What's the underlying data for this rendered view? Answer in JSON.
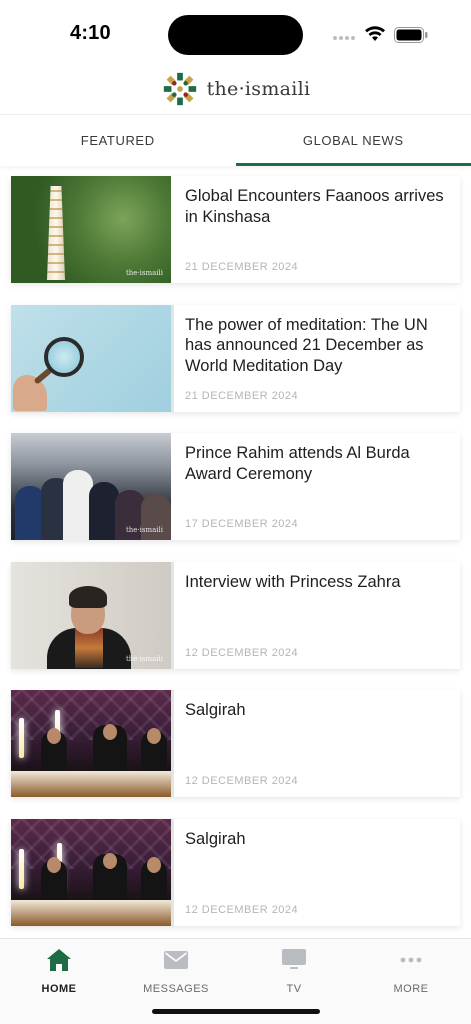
{
  "status_bar": {
    "time": "4:10"
  },
  "header": {
    "brand_text": "the·ismaili",
    "logo_icon": "ismaili-star-logo-icon",
    "brand_color": "#1e6b45"
  },
  "tabs": [
    {
      "label": "FEATURED",
      "active": false
    },
    {
      "label": "GLOBAL NEWS",
      "active": true
    }
  ],
  "articles": [
    {
      "title": "Global Encounters Faanoos arrives in Kinshasa",
      "date": "21 DECEMBER 2024",
      "watermark": "the·ismaili"
    },
    {
      "title": "The power of meditation: The UN has announced 21 December as World Meditation Day",
      "date": "21 DECEMBER 2024"
    },
    {
      "title": "Prince Rahim attends Al Burda Award Ceremony",
      "date": "17 DECEMBER 2024",
      "watermark": "the·ismaili"
    },
    {
      "title": "Interview with Princess Zahra",
      "date": "12 DECEMBER 2024",
      "watermark": "the·ismaili"
    },
    {
      "title": "Salgirah",
      "date": "12 DECEMBER 2024"
    },
    {
      "title": "Salgirah",
      "date": "12 DECEMBER 2024"
    }
  ],
  "bottom_nav": [
    {
      "label": "HOME",
      "icon": "home-icon",
      "active": true
    },
    {
      "label": "MESSAGES",
      "icon": "envelope-icon",
      "active": false
    },
    {
      "label": "TV",
      "icon": "tv-icon",
      "active": false
    },
    {
      "label": "MORE",
      "icon": "more-dots-icon",
      "active": false
    }
  ],
  "colors": {
    "accent": "#1e6b45",
    "date_text": "#b5b5b5",
    "inactive_icon": "#b9bcc0"
  }
}
